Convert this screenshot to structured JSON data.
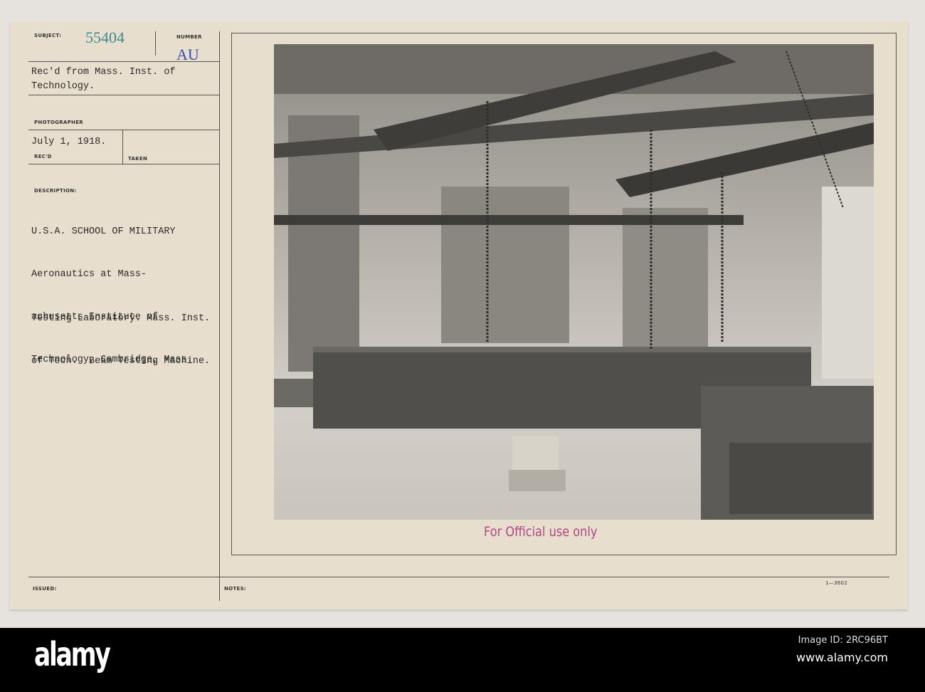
{
  "card": {
    "subject_label": "SUBJECT:",
    "subject_number": "55404",
    "number_label": "NUMBER",
    "number_value": "AU",
    "received_from": [
      "Rec'd from Mass. Inst. of",
      "Technology."
    ],
    "photographer_label": "PHOTOGRAPHER",
    "date": "July 1, 1918.",
    "recd_label": "REC'D",
    "taken_label": "TAKEN",
    "description_label": "DESCRIPTION:",
    "description": [
      "U.S.A. SCHOOL OF MILITARY",
      "Aeronautics at Mass-",
      "achusetts Institute of",
      "Technology, Cambridge, Mass."
    ],
    "caption": [
      "Testing Laboratory. Mass. Inst.",
      "of Tech.  Beam Testing Machine."
    ],
    "stamp": "For Official use only",
    "issued_label": "ISSUED:",
    "notes_label": "NOTES:",
    "form_code": "1—3602"
  },
  "colors": {
    "subject_number": "#3f8a8f",
    "number_value": "#3a4fb0",
    "stamp": "#b0468a"
  },
  "footer": {
    "logo": "alamy",
    "image_id": "Image ID: 2RC96BT",
    "url": "www.alamy.com"
  }
}
